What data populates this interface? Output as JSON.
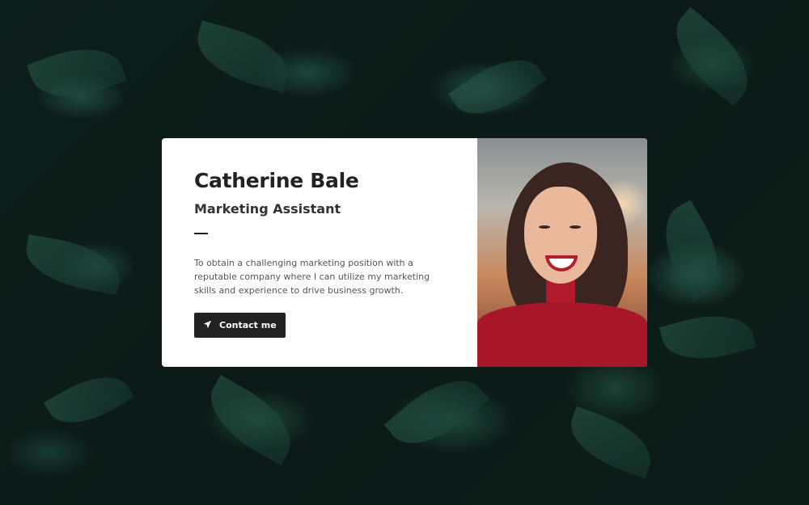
{
  "profile": {
    "name": "Catherine Bale",
    "title": "Marketing Assistant",
    "bio": "To obtain a challenging marketing position with a reputable company where I can utilize my marketing skills and experience to drive business growth.",
    "contact_label": "Contact me",
    "contact_icon": "paper-plane-icon"
  },
  "colors": {
    "card_bg": "#ffffff",
    "button_bg": "#222222",
    "text_primary": "#222222",
    "background": "#0a1512"
  }
}
